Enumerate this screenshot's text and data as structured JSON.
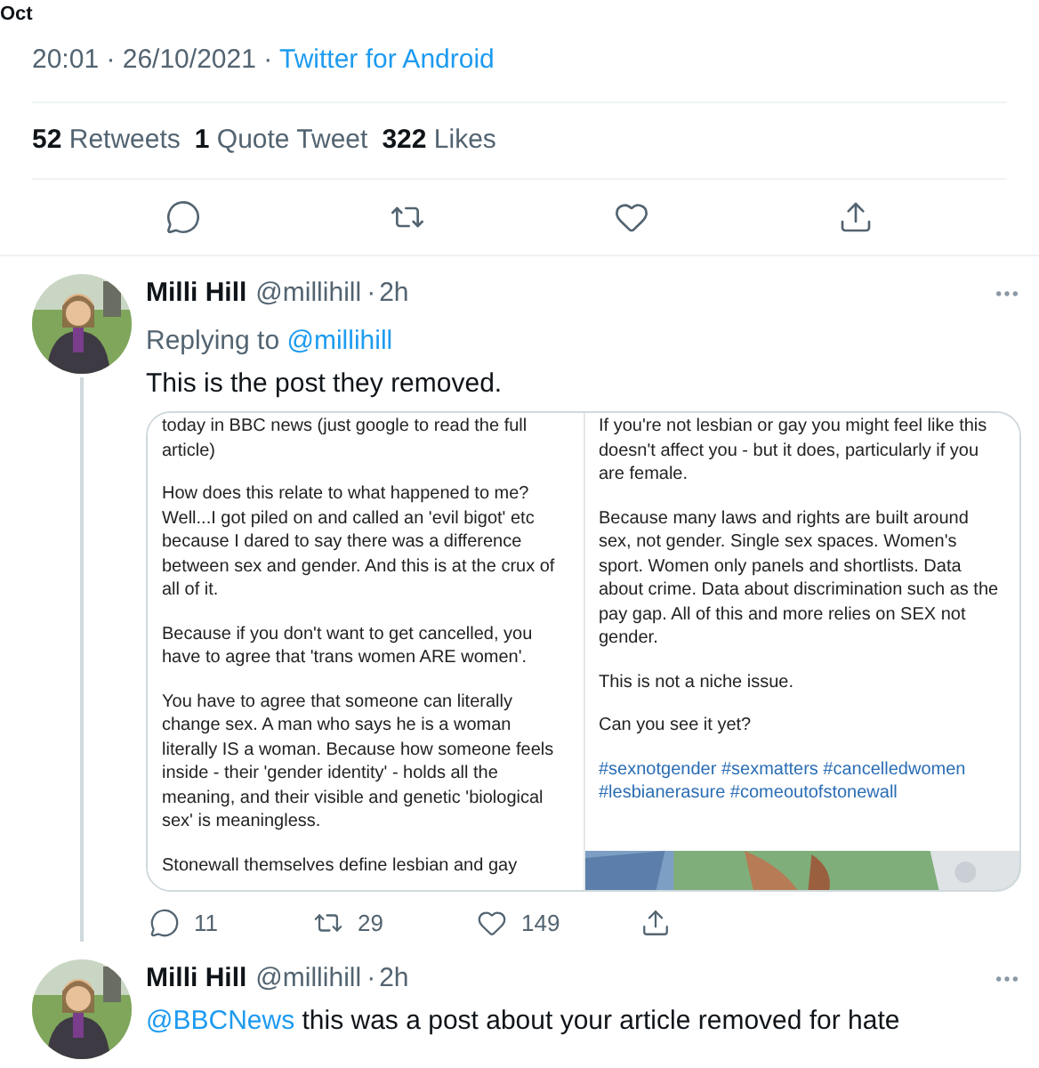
{
  "top_fragment": "Oct",
  "timestamp": {
    "text": "20:01 · 26/10/2021 · ",
    "source": "Twitter for Android"
  },
  "stats": [
    {
      "count": "52",
      "label": "Retweets"
    },
    {
      "count": "1",
      "label": "Quote Tweet"
    },
    {
      "count": "322",
      "label": "Likes"
    }
  ],
  "actions": [
    {
      "kind": "reply"
    },
    {
      "kind": "retweet"
    },
    {
      "kind": "like"
    },
    {
      "kind": "share"
    }
  ],
  "replies": [
    {
      "name": "Milli Hill",
      "handle": "@millihill",
      "separator": "·",
      "time": "2h",
      "replying_prefix": "Replying to",
      "replying_handle": "@millihill",
      "parts": [
        {
          "kind": "text",
          "text": "This is the post they removed."
        }
      ],
      "media": [
        {
          "paragraphs": [
            {
              "kind": "text",
              "text": "today in BBC news (just google to read the full article)"
            },
            {
              "kind": "text",
              "text": "How does this relate to what happened to me? Well...I got piled on and called an 'evil bigot' etc because I dared to say there was a difference between sex and gender. And this is at the crux of all of it."
            },
            {
              "kind": "text",
              "text": "Because if you don't want to get cancelled, you have to agree that 'trans women ARE women'."
            },
            {
              "kind": "text",
              "text": "You have to agree that someone can literally change sex. A man who says he is a woman literally IS a woman. Because how someone feels inside - their 'gender identity' - holds all the meaning, and their visible and genetic 'biological sex' is meaningless."
            },
            {
              "kind": "text",
              "text": "Stonewall themselves define lesbian and gay"
            }
          ]
        },
        {
          "paragraphs": [
            {
              "kind": "text",
              "text": "If you're not lesbian or gay you might feel like this doesn't affect you - but it does, particularly if you are female."
            },
            {
              "kind": "text",
              "text": "Because many laws and rights are built around sex, not gender. Single sex spaces. Women's sport. Women only panels and shortlists. Data about crime. Data about discrimination such as the pay gap. All of this and more relies on SEX not gender."
            },
            {
              "kind": "text",
              "text": "This is not a niche issue."
            },
            {
              "kind": "text",
              "text": "Can you see it yet?"
            },
            {
              "kind": "hashtags",
              "text": "#sexnotgender #sexmatters #cancelledwomen #lesbianerasure #comeoutofstonewall"
            }
          ]
        }
      ],
      "actions": [
        {
          "kind": "reply",
          "count": "11"
        },
        {
          "kind": "retweet",
          "count": "29"
        },
        {
          "kind": "like",
          "count": "149"
        },
        {
          "kind": "share"
        }
      ]
    },
    {
      "name": "Milli Hill",
      "handle": "@millihill",
      "separator": "·",
      "time": "2h",
      "parts": [
        {
          "kind": "mention",
          "text": "@BBCNews"
        },
        {
          "kind": "text",
          "text": " this was a post about your article removed for hate"
        }
      ]
    }
  ]
}
